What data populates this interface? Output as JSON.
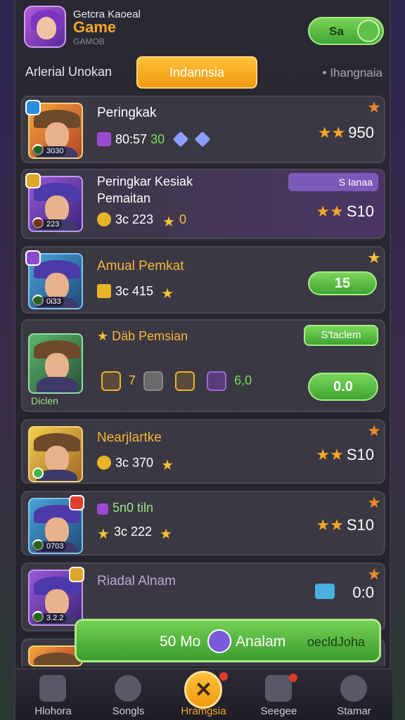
{
  "header": {
    "line1": "Getcra Kaoeal",
    "line2": "Game",
    "line3": "GAMOB",
    "toggle_label": "Sa"
  },
  "tabs": {
    "left": "Arlerial Unokan",
    "active": "Indannsia",
    "right": "• Ihangnaia"
  },
  "rows": [
    {
      "title": "Peringkak",
      "stat_a": "80:57",
      "stat_b": "30",
      "score": "950",
      "level": "3030"
    },
    {
      "title": "Peringkar Kesiak",
      "title2": "Pemaitan",
      "stat": "3c 223",
      "stat_b": "0",
      "score": "S10",
      "pill": "S Ianaa",
      "level": "223"
    },
    {
      "title": "Amual Pemkat",
      "stat": "3c 415",
      "button": "15",
      "level": "0i33"
    },
    {
      "title": "Däb Pemsian",
      "pill": "S'taclem",
      "num_a": "7",
      "num_b": "6,0",
      "button": "0.0",
      "level": "Diclen"
    },
    {
      "title": "Nearjlartke",
      "stat": "3c 370",
      "score": "S10"
    },
    {
      "title": "5n0 tiln",
      "stat": "3c 222",
      "score": "S10",
      "level": "0703"
    },
    {
      "title": "Riadal Alnam",
      "score": "0:0",
      "level": "3.2.2"
    }
  ],
  "cta": {
    "left": "50 Mo",
    "middle": "Analam",
    "right": "oecldJoha"
  },
  "nav": [
    {
      "label": "Hlohora",
      "icon": "home-icon"
    },
    {
      "label": "Songls",
      "icon": "helmet-icon"
    },
    {
      "label": "Hramgsia",
      "icon": "close-icon"
    },
    {
      "label": "Seegee",
      "icon": "inbox-icon"
    },
    {
      "label": "Stamar",
      "icon": "target-icon"
    }
  ],
  "colors": {
    "accent": "#f5a623",
    "green": "#4fbf3a",
    "panel": "#2a2833"
  }
}
